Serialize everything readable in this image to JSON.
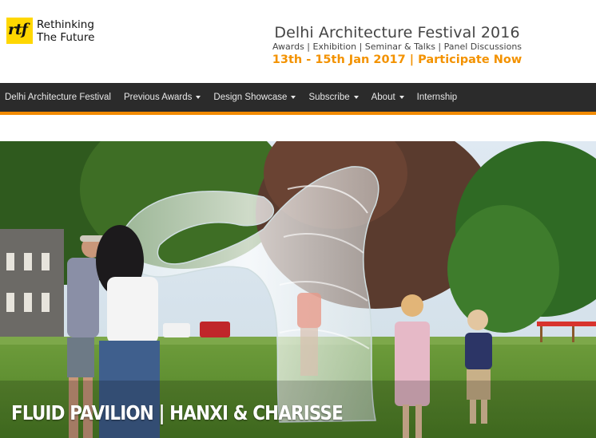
{
  "logo": {
    "mark": "rtf",
    "line1": "Rethinking",
    "line2": "The Future"
  },
  "banner": {
    "title": "Delhi Architecture Festival 2016",
    "subtitle": "Awards | Exhibition | Seminar & Talks | Panel Discussions",
    "cta": "13th - 15th Jan 2017 | Participate Now"
  },
  "nav": {
    "items": [
      {
        "label": "Delhi Architecture Festival"
      },
      {
        "label": "Previous Awards",
        "dropdown": true
      },
      {
        "label": "Design Showcase",
        "dropdown": true
      },
      {
        "label": "Subscribe",
        "dropdown": true
      },
      {
        "label": "About",
        "dropdown": true
      },
      {
        "label": "Internship"
      }
    ]
  },
  "hero": {
    "caption": "FLUID PAVILION  |  HANXI & CHARISSE"
  },
  "colors": {
    "accent": "#f28a00",
    "nav_bg": "#2b2b2b",
    "logo_bg": "#ffd700"
  }
}
